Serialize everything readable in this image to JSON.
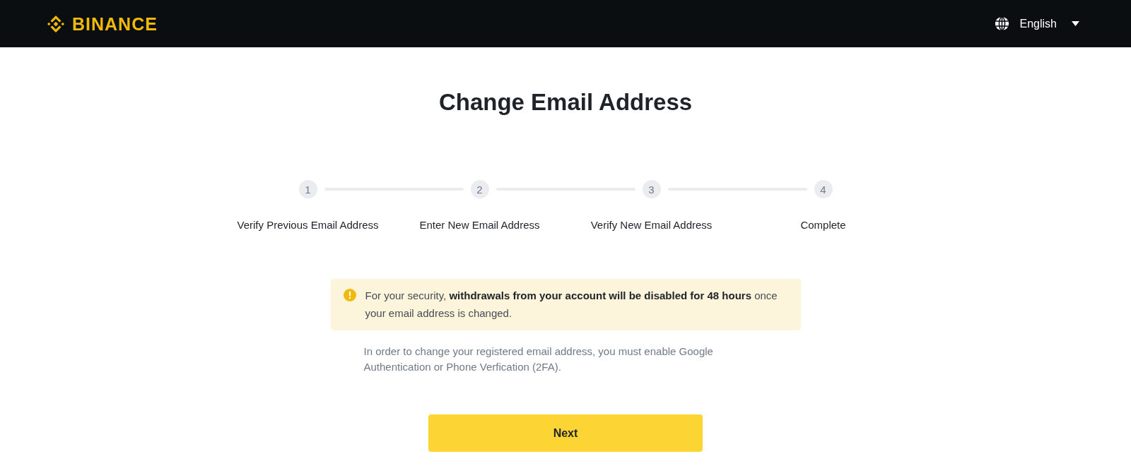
{
  "header": {
    "logo": {
      "text": "BINANCE"
    },
    "language": {
      "label": "English"
    }
  },
  "title": "Change Email Address",
  "steps": [
    {
      "number": "1",
      "label": "Verify Previous Email Address"
    },
    {
      "number": "2",
      "label": "Enter New Email Address"
    },
    {
      "number": "3",
      "label": "Verify New Email Address"
    },
    {
      "number": "4",
      "label": "Complete"
    }
  ],
  "alert": {
    "text": "For your security, **withdrawals from your account will be disabled for 48 hours** once your email address is changed."
  },
  "note": "In order to change your registered email address, you must enable Google Authentication or Phone Verfication (2FA).",
  "primary_button": {
    "label": "Next"
  }
}
